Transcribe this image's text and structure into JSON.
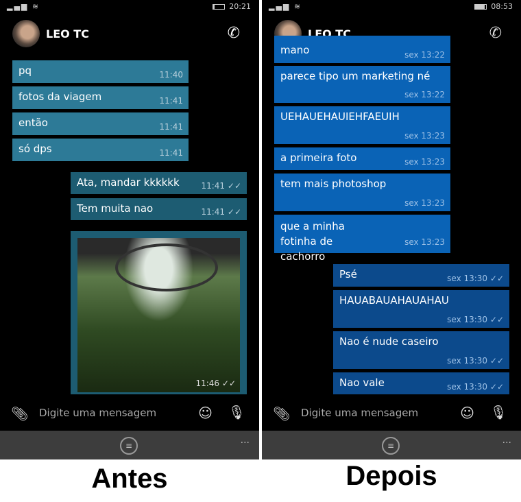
{
  "left": {
    "status": {
      "time": "20:21",
      "battery": 0.15
    },
    "contact": "LEO TC",
    "messages": [
      {
        "dir": "in",
        "text": "pq",
        "time": "11:40"
      },
      {
        "dir": "in",
        "text": "fotos da viagem",
        "time": "11:41"
      },
      {
        "dir": "in",
        "text": "então",
        "time": "11:41"
      },
      {
        "dir": "in",
        "text": "só dps",
        "time": "11:41"
      },
      {
        "dir": "out",
        "text": "Ata, mandar kkkkkk",
        "time": "11:41"
      },
      {
        "dir": "out",
        "text": "Tem muita nao",
        "time": "11:41"
      },
      {
        "dir": "out",
        "type": "image",
        "time": "11:46"
      }
    ],
    "input_placeholder": "Digite uma mensagem",
    "caption": "Antes"
  },
  "right": {
    "status": {
      "time": "08:53",
      "battery": 0.9
    },
    "contact": "LEO TC",
    "messages": [
      {
        "dir": "in",
        "text": "mano",
        "time": "sex 13:22"
      },
      {
        "dir": "in",
        "text": "parece tipo um marketing né",
        "time": "sex 13:22"
      },
      {
        "dir": "in",
        "text": "UEHAUEHAUIEHFAEUIH",
        "time": "sex 13:23"
      },
      {
        "dir": "in",
        "text": "a primeira foto",
        "time": "sex 13:23"
      },
      {
        "dir": "in",
        "text": "tem mais photoshop",
        "time": "sex 13:23"
      },
      {
        "dir": "in",
        "text": "que a minha fotinha de cachorro",
        "time": "sex 13:23"
      },
      {
        "dir": "out",
        "text": "Psé",
        "time": "sex 13:30"
      },
      {
        "dir": "out",
        "text": "HAUABAUAHAUAHAU",
        "time": "sex 13:30"
      },
      {
        "dir": "out",
        "text": "Nao é nude caseiro",
        "time": "sex 13:30"
      },
      {
        "dir": "out",
        "text": "Nao vale",
        "time": "sex 13:30"
      }
    ],
    "input_placeholder": "Digite uma mensagem",
    "caption": "Depois"
  },
  "colors": {
    "left_in": "#2d7a97",
    "left_out": "#1d5c72",
    "right_in": "#0a63b6",
    "right_out": "#0c4a8c"
  },
  "ticks": "✓✓",
  "more": "···"
}
